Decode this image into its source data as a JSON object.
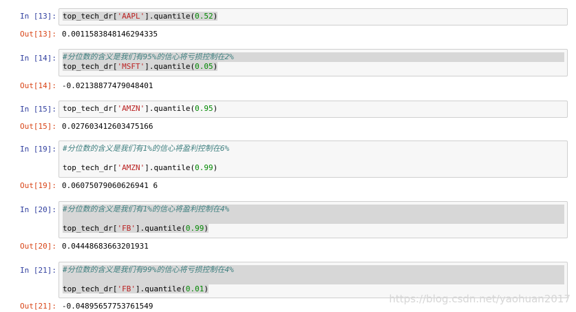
{
  "cells": [
    {
      "in_prompt": "In [13]:",
      "comment": "",
      "code": {
        "var": "top_tech_dr[",
        "key": "'AAPL'",
        "mid": "].quantile(",
        "arg": "0.52",
        "end": ")"
      },
      "out_prompt": "Out[13]:",
      "output": "0.0011583848146294335"
    },
    {
      "in_prompt": "In [14]:",
      "comment": "#分位数的含义是我们有95%的信心将亏损控制在2%",
      "code": {
        "var": "top_tech_dr[",
        "key": "'MSFT'",
        "mid": "].quantile(",
        "arg": "0.05",
        "end": ")"
      },
      "out_prompt": "Out[14]:",
      "output": "-0.02138877479048401"
    },
    {
      "in_prompt": "In [15]:",
      "comment": "",
      "code": {
        "var": "top_tech_dr[",
        "key": "'AMZN'",
        "mid": "].quantile(",
        "arg": "0.95",
        "end": ")"
      },
      "out_prompt": "Out[15]:",
      "output": "0.027603412603475166"
    },
    {
      "in_prompt": "In [19]:",
      "comment": "#分位数的含义是我们有1%的信心将盈利控制在6%",
      "code": {
        "var": "top_tech_dr[",
        "key": "'AMZN'",
        "mid": "].quantile(",
        "arg": "0.99",
        "end": ")"
      },
      "out_prompt": "Out[19]:",
      "output": "0.06075079060626941 6"
    },
    {
      "in_prompt": "In [20]:",
      "comment": "#分位数的含义是我们有1%的信心将盈利控制在4%",
      "code": {
        "var": "top_tech_dr[",
        "key": "'FB'",
        "mid": "].quantile(",
        "arg": "0.99",
        "end": ")"
      },
      "out_prompt": "Out[20]:",
      "output": "0.04448683663201931"
    },
    {
      "in_prompt": "In [21]:",
      "comment": "#分位数的含义是我们有99%的信心将亏损控制在4%",
      "code": {
        "var": "top_tech_dr[",
        "key": "'FB'",
        "mid": "].quantile(",
        "arg": "0.01",
        "end": ")"
      },
      "out_prompt": "Out[21]:",
      "output": "-0.04895657753761549"
    }
  ],
  "watermark": "https://blog.csdn.net/yaohuan2017"
}
